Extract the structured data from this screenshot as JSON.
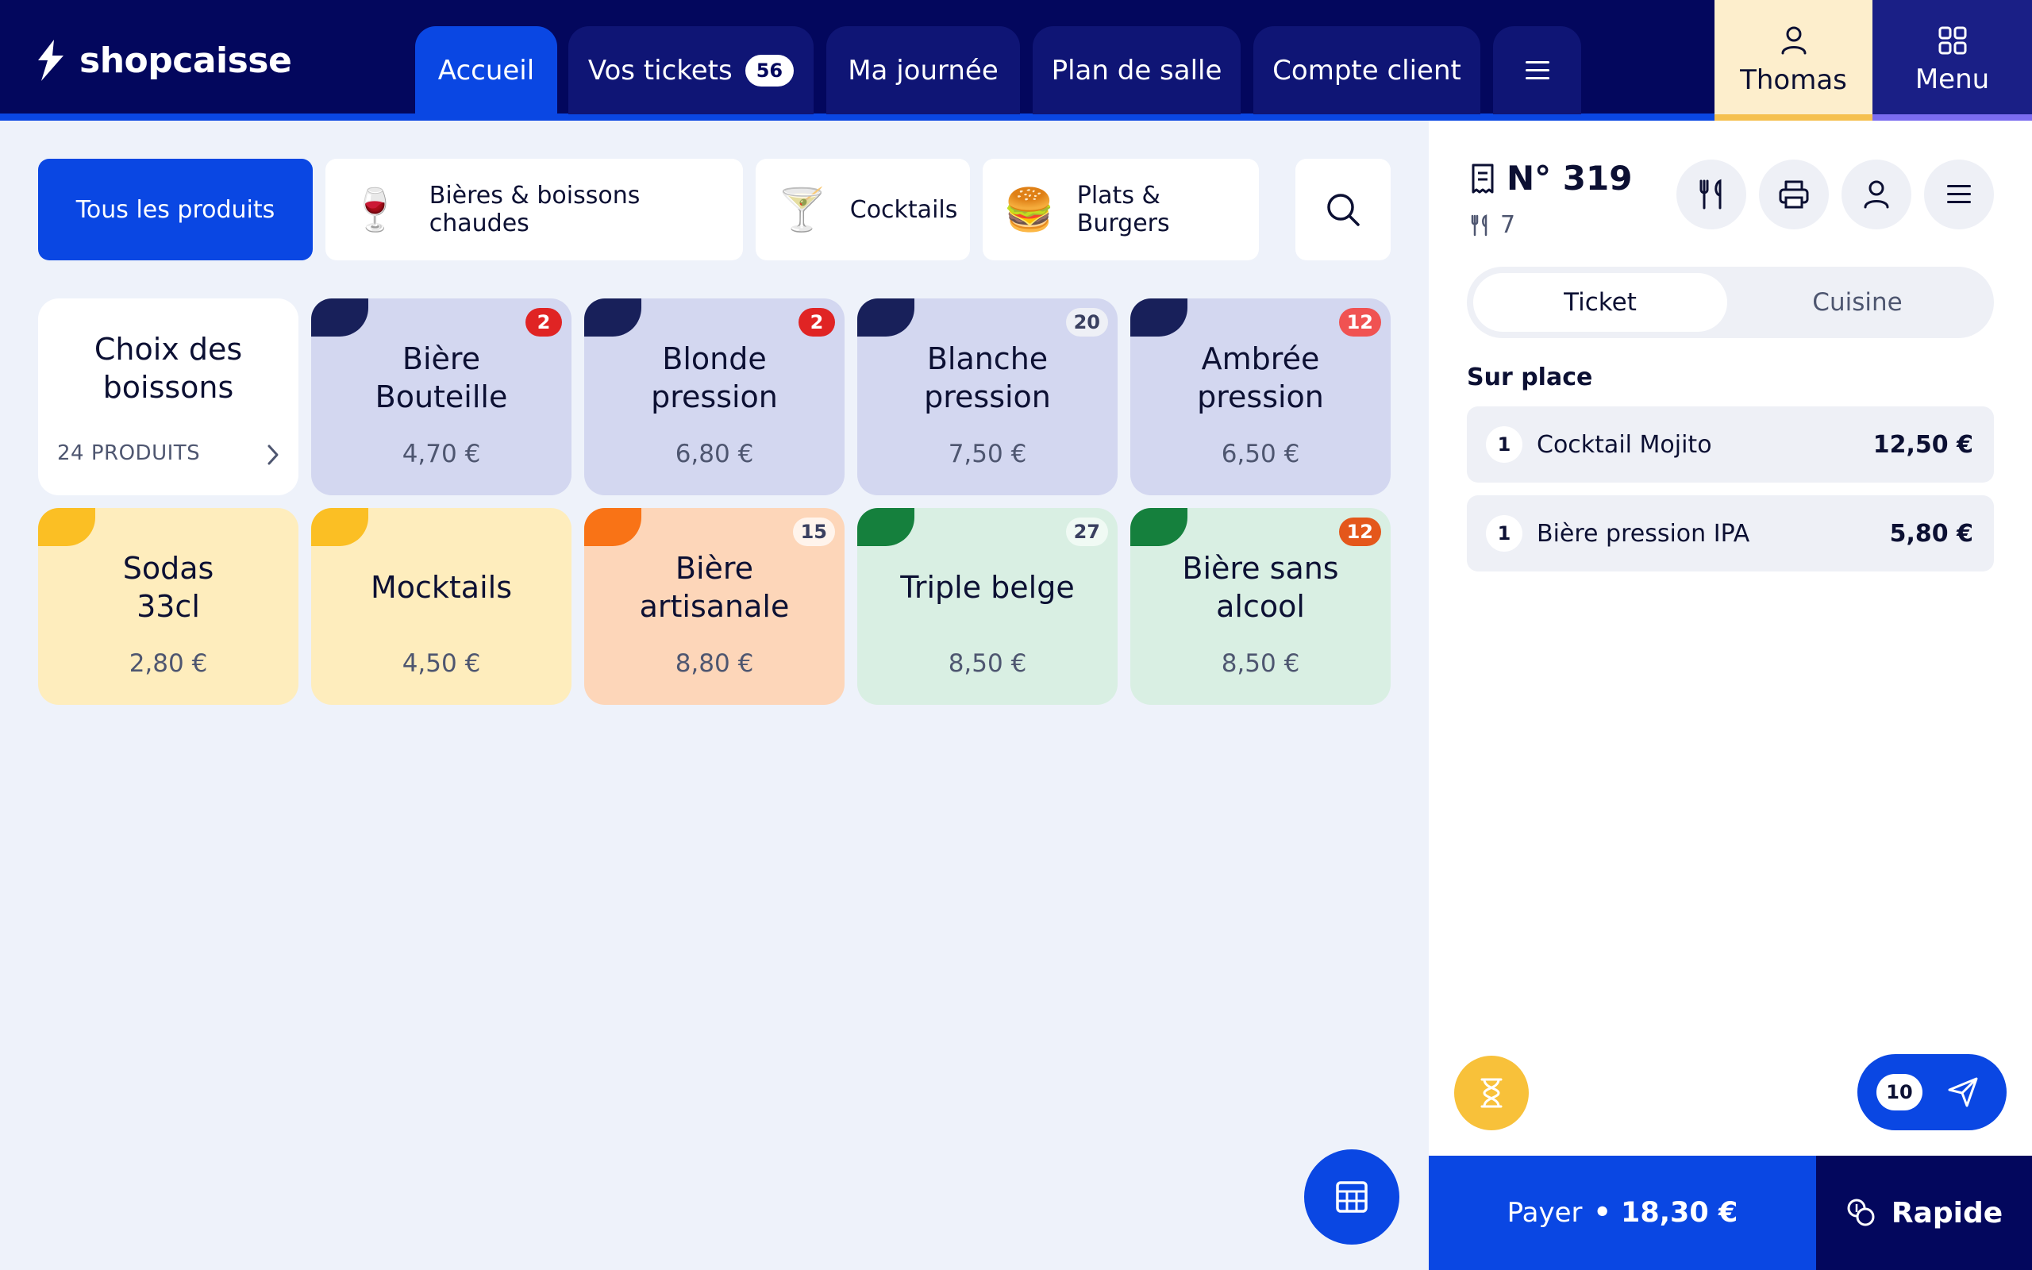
{
  "app": {
    "logo_text": "shopcaisse"
  },
  "nav": {
    "tabs": [
      {
        "label": "Accueil",
        "active": true
      },
      {
        "label": "Vos tickets",
        "badge": "56"
      },
      {
        "label": "Ma journée"
      },
      {
        "label": "Plan de salle"
      },
      {
        "label": "Compte client"
      }
    ],
    "more_icon": "hamburger-icon",
    "user_label": "Thomas",
    "menu_label": "Menu"
  },
  "categories": [
    {
      "label": "Tous les produits",
      "active": true
    },
    {
      "label": "Bières & boissons chaudes",
      "icon": "🍷"
    },
    {
      "label": "Cocktails",
      "icon": "🍸"
    },
    {
      "label": "Plats & Burgers",
      "icon": "🍔"
    }
  ],
  "products": [
    {
      "name": "Choix des\nboissons",
      "sub": "24 PRODUITS",
      "kind": "folder"
    },
    {
      "name": "Bière\nBouteille",
      "price": "4,70 €",
      "badge": "2",
      "bg": "#d3d7f0",
      "corner": "#18205a",
      "badge_bg": "#e02424",
      "badge_fg": "#ffffff"
    },
    {
      "name": "Blonde\npression",
      "price": "6,80 €",
      "badge": "2",
      "bg": "#d3d7f0",
      "corner": "#18205a",
      "badge_bg": "#e02424",
      "badge_fg": "#ffffff"
    },
    {
      "name": "Blanche\npression",
      "price": "7,50 €",
      "badge": "20",
      "bg": "#d3d7f0",
      "corner": "#18205a",
      "badge_bg": "#eef0f6",
      "badge_fg": "#3a4060"
    },
    {
      "name": "Ambrée\npression",
      "price": "6,50 €",
      "badge": "12",
      "bg": "#d3d7f0",
      "corner": "#18205a",
      "badge_bg": "#f05252",
      "badge_fg": "#ffffff"
    },
    {
      "name": "Sodas\n33cl",
      "price": "2,80 €",
      "bg": "#feedbd",
      "corner": "#fbbf24"
    },
    {
      "name": "Mocktails",
      "price": "4,50 €",
      "bg": "#feedbd",
      "corner": "#fbbf24"
    },
    {
      "name": "Bière\nartisanale",
      "price": "8,80 €",
      "badge": "15",
      "bg": "#fdd6b9",
      "corner": "#f97316",
      "badge_bg": "#fff4ec",
      "badge_fg": "#3a4060"
    },
    {
      "name": "Triple belge",
      "price": "8,50 €",
      "badge": "27",
      "bg": "#d9efe3",
      "corner": "#15803d",
      "badge_bg": "#f0faf4",
      "badge_fg": "#3a4060"
    },
    {
      "name": "Bière sans\nalcool",
      "price": "8,50 €",
      "badge": "12",
      "bg": "#d9efe3",
      "corner": "#15803d",
      "badge_bg": "#e4571b",
      "badge_fg": "#ffffff"
    }
  ],
  "ticket": {
    "number": "N° 319",
    "table": "7",
    "tabs": {
      "ticket": "Ticket",
      "kitchen": "Cuisine"
    },
    "section": "Sur place",
    "lines": [
      {
        "qty": "1",
        "name": "Cocktail Mojito",
        "price": "12,50 €"
      },
      {
        "qty": "1",
        "name": "Bière pression IPA",
        "price": "5,80 €"
      }
    ],
    "send_count": "10",
    "pay_label": "Payer",
    "pay_amount": "• 18,30 €",
    "quick_label": "Rapide"
  },
  "colors": {
    "navy": "#03075d",
    "accent": "#0a47e3",
    "yellow": "#f8c13a"
  }
}
